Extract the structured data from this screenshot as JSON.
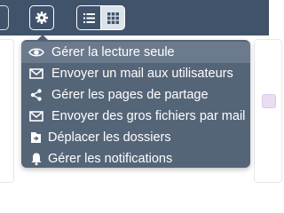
{
  "toolbar": {
    "settings_icon": "gear-icon",
    "view_list_icon": "list-icon",
    "view_grid_icon": "grid-icon",
    "colors": {
      "bar": "#41536a",
      "grid_active": "#dde3ea"
    }
  },
  "menu": {
    "background": "#556578",
    "items": [
      {
        "label": "Gérer la lecture seule",
        "icon": "eye-icon",
        "active": true
      },
      {
        "label": "Envoyer un mail aux utilisateurs",
        "icon": "envelope-icon"
      },
      {
        "label": "Gérer les pages de partage",
        "icon": "share-icon"
      },
      {
        "label": "Envoyer des gros fichiers par mail",
        "icon": "envelope-icon"
      },
      {
        "label": "Déplacer les dossiers",
        "icon": "move-folder-icon"
      },
      {
        "label": "Gérer les notifications",
        "icon": "bell-icon"
      }
    ]
  }
}
